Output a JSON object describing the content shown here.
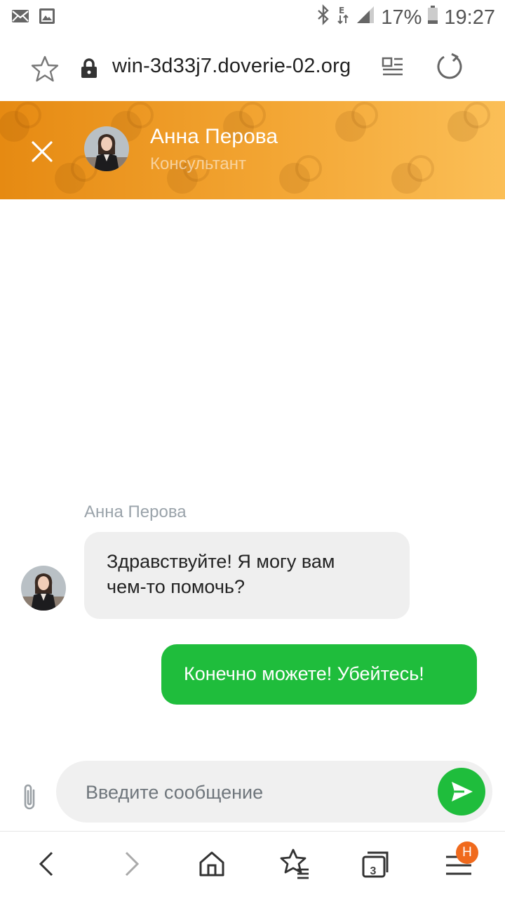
{
  "status_bar": {
    "battery": "17%",
    "time": "19:27",
    "icons": [
      "mail-icon",
      "image-icon",
      "bluetooth-icon",
      "network-e-icon",
      "signal-icon",
      "battery-icon"
    ]
  },
  "browser": {
    "url": "win-3d33j7.doverie-02.org",
    "icons": [
      "star-icon",
      "lock-icon",
      "reader-mode-icon",
      "reload-icon"
    ]
  },
  "chat_header": {
    "name": "Анна Перова",
    "role": "Консультант",
    "colors": {
      "start": "#e68a12",
      "end": "#fbbf57"
    }
  },
  "messages": [
    {
      "sender": "Анна Перова",
      "direction": "incoming",
      "text_lines": [
        "Здравствуйте! Я могу вам",
        "чем-то помочь?"
      ]
    },
    {
      "direction": "outgoing",
      "text": "Конечно можете! Убейтесь!"
    }
  ],
  "composer": {
    "placeholder": "Введите сообщение",
    "accent": "#1fbd3c"
  },
  "bottom_nav": {
    "items": [
      "back-icon",
      "forward-icon",
      "home-icon",
      "bookmarks-icon",
      "tabs-icon",
      "menu-icon"
    ],
    "tabs_count": "3",
    "menu_badge": "H",
    "badge_color": "#f06a1d"
  }
}
